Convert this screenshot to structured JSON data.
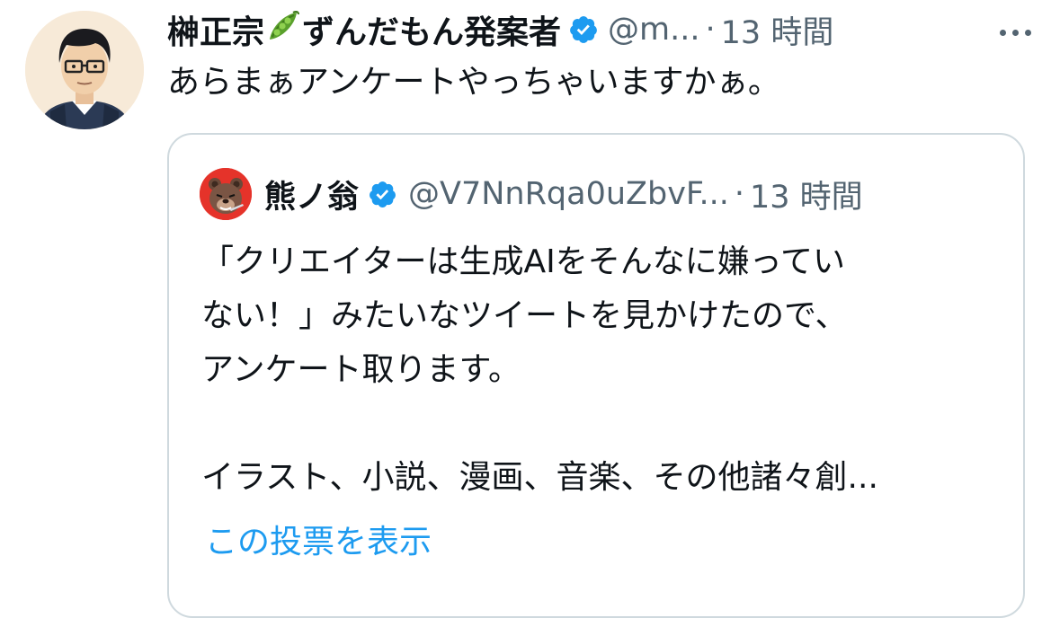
{
  "tweet": {
    "display_name_prefix": "榊正宗",
    "name_emoji": "pea-pod-emoji",
    "display_name_suffix": "ずんだもん発案者",
    "handle": "@m...",
    "separator": "·",
    "time": "13 時間",
    "text": "あらまぁアンケートやっちゃいますかぁ。",
    "more_icon": "more-dots-icon"
  },
  "quoted": {
    "display_name": "熊ノ翁",
    "handle": "@V7NnRqa0uZbvF...",
    "separator": "·",
    "time": "13 時間",
    "lines": [
      "「クリエイターは生成AIをそんなに嫌ってい",
      "ない！」みたいなツイートを見かけたので、",
      "アンケート取ります。",
      "",
      "イラスト、小説、漫画、音楽、その他諸々創..."
    ],
    "poll_link": "この投票を表示"
  },
  "colors": {
    "primary_text": "#0f1419",
    "secondary_text": "#536471",
    "link": "#1d9bf0",
    "verified": "#1d9bf0",
    "border": "#cfd9de",
    "quoted_avatar_bg": "#e5332a"
  }
}
